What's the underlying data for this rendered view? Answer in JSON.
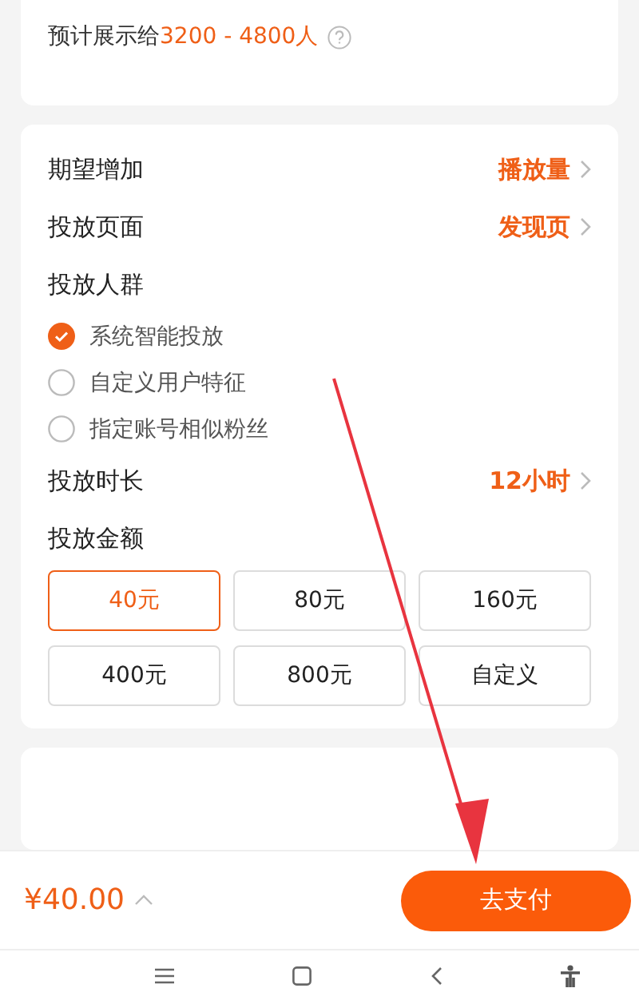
{
  "estimate": {
    "label": "预计展示给",
    "range": "3200 - 4800人"
  },
  "settings": [
    {
      "label": "期望增加",
      "value": "播放量"
    },
    {
      "label": "投放页面",
      "value": "发现页"
    }
  ],
  "audience": {
    "label": "投放人群",
    "options": [
      {
        "label": "系统智能投放",
        "selected": true
      },
      {
        "label": "自定义用户特征",
        "selected": false
      },
      {
        "label": "指定账号相似粉丝",
        "selected": false
      }
    ]
  },
  "duration": {
    "label": "投放时长",
    "value": "12小时"
  },
  "amount": {
    "label": "投放金额",
    "options": [
      {
        "label": "40元",
        "selected": true
      },
      {
        "label": "80元",
        "selected": false
      },
      {
        "label": "160元",
        "selected": false
      },
      {
        "label": "400元",
        "selected": false
      },
      {
        "label": "800元",
        "selected": false
      },
      {
        "label": "自定义",
        "selected": false
      }
    ]
  },
  "footer": {
    "price": "¥40.00",
    "pay_button": "去支付"
  }
}
